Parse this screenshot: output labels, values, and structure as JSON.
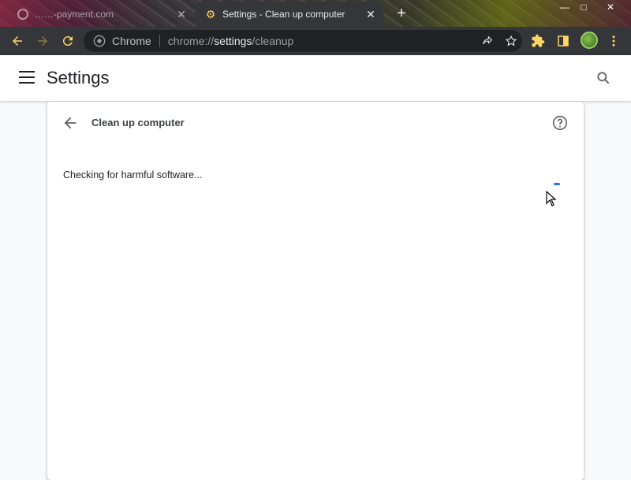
{
  "tabs": [
    {
      "title": "……-payment.com",
      "active": false,
      "close": "✕"
    },
    {
      "title": "Settings - Clean up computer",
      "active": true,
      "close": "✕"
    }
  ],
  "new_tab": "+",
  "window_controls": {
    "minimize": "—",
    "maximize": "□",
    "close": "✕"
  },
  "omnibox": {
    "site_label": "Chrome",
    "url_prefix": "chrome://",
    "url_host": "settings",
    "url_path": "/cleanup"
  },
  "settings": {
    "title": "Settings"
  },
  "cleanup": {
    "title": "Clean up computer",
    "status": "Checking for harmful software..."
  },
  "colors": {
    "toolbar_bg": "#35363a",
    "omnibox_bg": "#202124",
    "accent": "#1a73e8",
    "extension_icon": "#fdd663"
  }
}
